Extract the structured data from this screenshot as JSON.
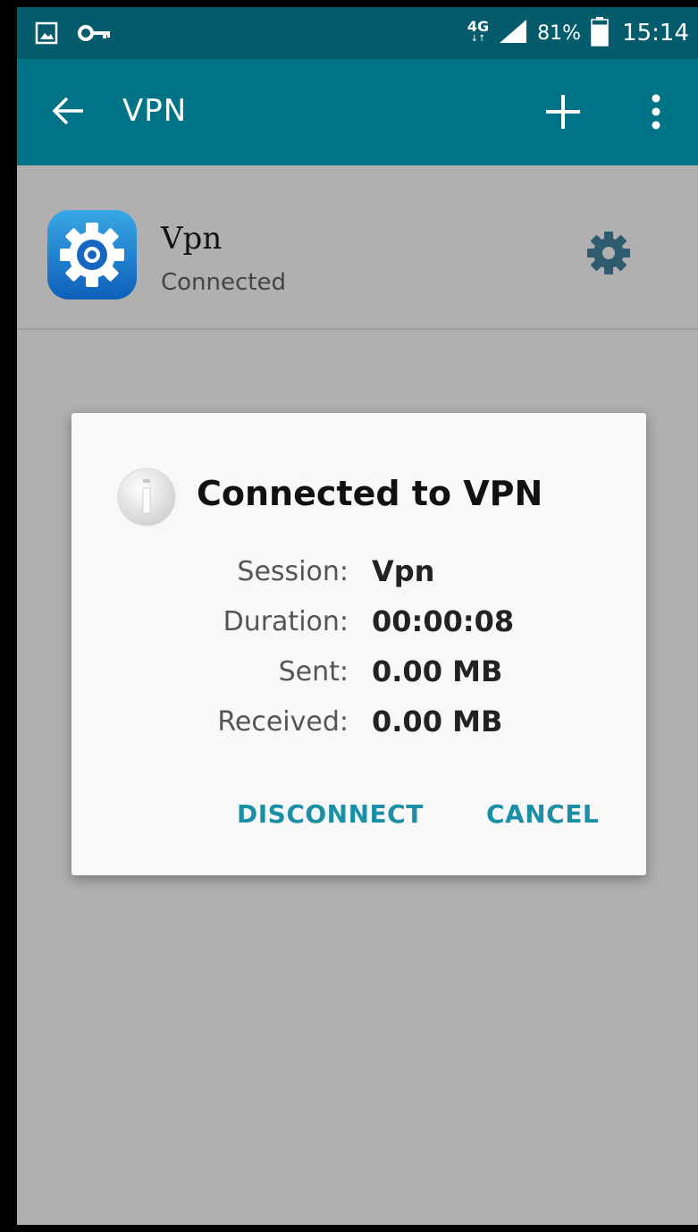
{
  "status_bar": {
    "network": "4G",
    "network_sub": "↓↑",
    "battery_percent": "81%",
    "time": "15:14",
    "battery_level": 0.81
  },
  "toolbar": {
    "title": "VPN"
  },
  "list": {
    "items": [
      {
        "title": "Vpn",
        "subtitle": "Connected"
      }
    ]
  },
  "dialog": {
    "title": "Connected to VPN",
    "rows": [
      {
        "label": "Session:",
        "value": "Vpn"
      },
      {
        "label": "Duration:",
        "value": "00:00:08"
      },
      {
        "label": "Sent:",
        "value": "0.00 MB"
      },
      {
        "label": "Received:",
        "value": "0.00 MB"
      }
    ],
    "buttons": {
      "disconnect": "DISCONNECT",
      "cancel": "CANCEL"
    }
  },
  "colors": {
    "status_bar": "#035b6b",
    "toolbar": "#017386",
    "accent": "#1a8fa6",
    "background": "#b0b0b0",
    "dialog": "#f8f8f8"
  },
  "icons": {
    "status_left": [
      "gallery-icon",
      "vpn-key-icon"
    ],
    "toolbar": [
      "back-arrow-icon",
      "add-icon",
      "more-vert-icon"
    ],
    "list": [
      "vpn-app-icon",
      "settings-gear-icon"
    ],
    "dialog": [
      "info-icon"
    ]
  }
}
